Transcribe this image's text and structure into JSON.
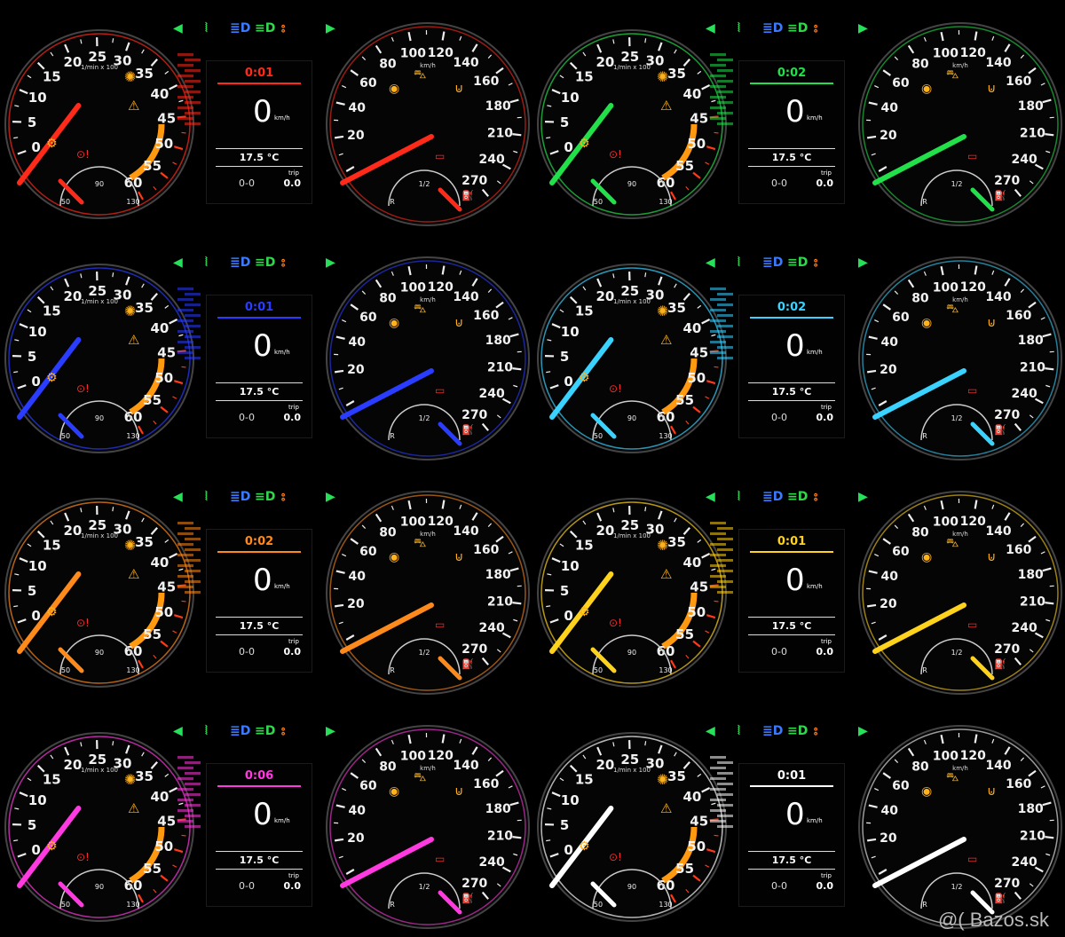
{
  "common": {
    "tach_labels": [
      "0",
      "5",
      "10",
      "15",
      "20",
      "25",
      "30",
      "35",
      "40",
      "45",
      "50",
      "55",
      "60"
    ],
    "tach_unit": "1/min x 100",
    "speed_labels": [
      "20",
      "40",
      "60",
      "80",
      "100",
      "120",
      "140",
      "160",
      "180",
      "210",
      "240",
      "270"
    ],
    "speed_unit": "km/h",
    "temp_gauge_labels": [
      "50",
      "90",
      "130"
    ],
    "fuel_gauge_labels": [
      "R",
      "1/2"
    ],
    "speed_value": "0",
    "speed_unit_small": "km/h",
    "outside_temp": "17.5 °C",
    "trip_label": "trip",
    "odometer": "0-0",
    "trip_value": "0.0"
  },
  "clusters": [
    {
      "time": "0:01",
      "accent": "#ff2a1a"
    },
    {
      "time": "0:02",
      "accent": "#22e04a"
    },
    {
      "time": "0:01",
      "accent": "#2a3cff"
    },
    {
      "time": "0:02",
      "accent": "#3ad2ff"
    },
    {
      "time": "0:02",
      "accent": "#ff8a1c"
    },
    {
      "time": "0:01",
      "accent": "#ffd21c"
    },
    {
      "time": "0:06",
      "accent": "#ff3ae0"
    },
    {
      "time": "0:01",
      "accent": "#ffffff"
    }
  ],
  "lamp_colors": {
    "arrow": "#27e05a",
    "blue": "#3a7bff",
    "green": "#32d64f",
    "amber": "#ff7b1c",
    "warning": "#ffb21c",
    "red": "#ff2a2a"
  },
  "icons": [
    "left-turn-arrow-icon",
    "parking-light-icon",
    "high-beam-icon",
    "low-beam-icon",
    "rear-fog-icon",
    "right-turn-arrow-icon"
  ],
  "watermark": "@( Bazos.sk"
}
